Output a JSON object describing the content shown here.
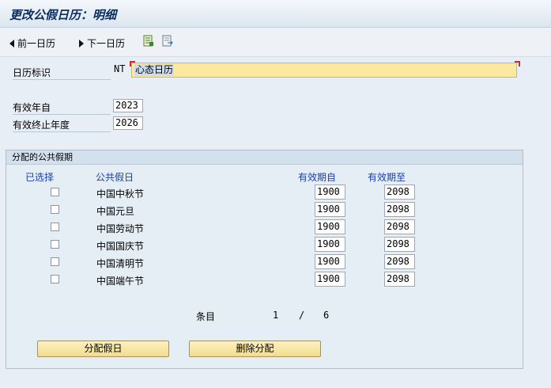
{
  "window": {
    "title": "更改公假日历：明细"
  },
  "toolbar": {
    "prev_label": "前一日历",
    "next_label": "下一日历",
    "prev_icon": "triangle-left-icon",
    "next_icon": "triangle-right-icon",
    "extra_icons": [
      "document-green-icon",
      "document-export-icon"
    ]
  },
  "header": {
    "calendar_label": "日历标识",
    "calendar_id": "NT",
    "calendar_name": "心态日历",
    "valid_from_label": "有效年自",
    "valid_from": "2023",
    "valid_to_label": "有效终止年度",
    "valid_to": "2026"
  },
  "assigned": {
    "title": "分配的公共假期",
    "columns": {
      "select": "已选择",
      "holiday": "公共假日",
      "from": "有效期自",
      "to": "有效期至"
    },
    "rows": [
      {
        "name": "中国中秋节",
        "from": "1900",
        "to": "2098",
        "checked": false
      },
      {
        "name": "中国元旦",
        "from": "1900",
        "to": "2098",
        "checked": false
      },
      {
        "name": "中国劳动节",
        "from": "1900",
        "to": "2098",
        "checked": false
      },
      {
        "name": "中国国庆节",
        "from": "1900",
        "to": "2098",
        "checked": false
      },
      {
        "name": "中国清明节",
        "from": "1900",
        "to": "2098",
        "checked": false
      },
      {
        "name": "中国端午节",
        "from": "1900",
        "to": "2098",
        "checked": false
      }
    ],
    "paging": {
      "label": "条目",
      "current": "1",
      "sep": "/",
      "total": "6"
    }
  },
  "buttons": {
    "assign": "分配假日",
    "delete": "删除分配"
  },
  "colors": {
    "accent": "#1a3fa8",
    "input_highlight": "#fbe9a2",
    "button": "#f3dc8e"
  }
}
